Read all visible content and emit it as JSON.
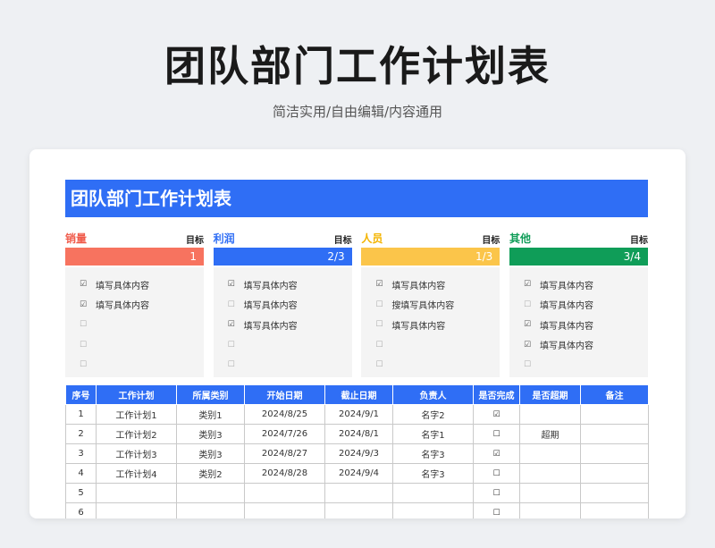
{
  "header": {
    "title": "团队部门工作计划表",
    "subtitle": "简洁实用/自由编辑/内容通用"
  },
  "sheet": {
    "banner": "团队部门工作计划表",
    "goal_label": "目标",
    "categories": [
      {
        "name": "销量",
        "value": "1",
        "color": "#f05a4a",
        "bar_color": "#f7735f",
        "items": [
          {
            "checked": true,
            "text": "填写具体内容"
          },
          {
            "checked": true,
            "text": "填写具体内容"
          },
          {
            "checked": false,
            "text": ""
          },
          {
            "checked": false,
            "text": ""
          },
          {
            "checked": false,
            "text": ""
          }
        ]
      },
      {
        "name": "利润",
        "value": "2/3",
        "color": "#2f6ef5",
        "bar_color": "#2f6ef5",
        "items": [
          {
            "checked": true,
            "text": "填写具体内容"
          },
          {
            "checked": false,
            "text": "填写具体内容"
          },
          {
            "checked": true,
            "text": "填写具体内容"
          },
          {
            "checked": false,
            "text": ""
          },
          {
            "checked": false,
            "text": ""
          }
        ]
      },
      {
        "name": "人员",
        "value": "1/3",
        "color": "#f4b400",
        "bar_color": "#fbc54a",
        "items": [
          {
            "checked": true,
            "text": "填写具体内容"
          },
          {
            "checked": false,
            "text": "搜填写具体内容"
          },
          {
            "checked": false,
            "text": "填写具体内容"
          },
          {
            "checked": false,
            "text": ""
          },
          {
            "checked": false,
            "text": ""
          }
        ]
      },
      {
        "name": "其他",
        "value": "3/4",
        "color": "#0f9d58",
        "bar_color": "#0f9d58",
        "items": [
          {
            "checked": true,
            "text": "填写具体内容"
          },
          {
            "checked": false,
            "text": "填写具体内容"
          },
          {
            "checked": true,
            "text": "填写具体内容"
          },
          {
            "checked": true,
            "text": "填写具体内容"
          },
          {
            "checked": false,
            "text": ""
          }
        ]
      }
    ],
    "checkbox_checked": "☑",
    "checkbox_empty": "☐",
    "table": {
      "columns": [
        "序号",
        "工作计划",
        "所属类别",
        "开始日期",
        "截止日期",
        "负责人",
        "是否完成",
        "是否超期",
        "备注"
      ],
      "rows": [
        [
          "1",
          "工作计划1",
          "类别1",
          "2024/8/25",
          "2024/9/1",
          "名字2",
          "☑",
          "",
          ""
        ],
        [
          "2",
          "工作计划2",
          "类别3",
          "2024/7/26",
          "2024/8/1",
          "名字1",
          "☐",
          "超期",
          ""
        ],
        [
          "3",
          "工作计划3",
          "类别3",
          "2024/8/27",
          "2024/9/3",
          "名字3",
          "☑",
          "",
          ""
        ],
        [
          "4",
          "工作计划4",
          "类别2",
          "2024/8/28",
          "2024/9/4",
          "名字3",
          "☐",
          "",
          ""
        ],
        [
          "5",
          "",
          "",
          "",
          "",
          "",
          "☐",
          "",
          ""
        ],
        [
          "6",
          "",
          "",
          "",
          "",
          "",
          "☐",
          "",
          ""
        ]
      ]
    }
  }
}
